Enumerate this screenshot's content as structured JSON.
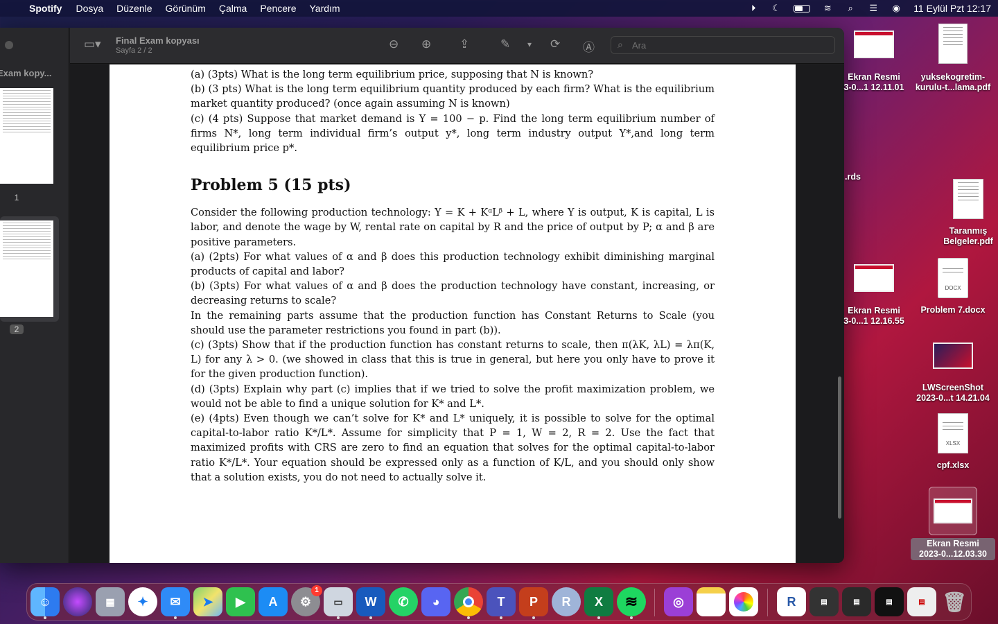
{
  "menubar": {
    "app_name": "Spotify",
    "items": [
      "Dosya",
      "Düzenle",
      "Görünüm",
      "Çalma",
      "Pencere",
      "Yardım"
    ],
    "datetime": "11 Eylül Pzt  12:17"
  },
  "viewer": {
    "sidebar_doc_title": "Exam kopy...",
    "thumb_labels": [
      "1",
      "2"
    ],
    "doc_title": "Final Exam kopyası",
    "page_indicator": "Sayfa 2 / 2",
    "search_placeholder": "Ara"
  },
  "document": {
    "p_a": "(a) (3pts) What is the long term equilibrium price, supposing that N is known?",
    "p_b": "(b) (3 pts) What is the long term equilibrium quantity produced by each firm?  What is the equilibrium market quantity produced? (once again assuming N is known)",
    "p_c": "(c) (4 pts) Suppose that market demand is Y = 100 − p.  Find the long term equilibrium number of firms N*, long term individual firm’s output y*, long term industry output Y*,and long term equilibrium price p*.",
    "problem_title": "Problem 5 (15 pts)",
    "p5_intro": "Consider the following production technology: Y = K + KᵅLᵝ + L, where Y is output, K is capital, L is labor, and denote the wage by W, rental rate on capital by R and the price of output by P; α and β are positive parameters.",
    "p5_a": "(a) (2pts) For what values of α and β does this production technology exhibit diminishing marginal products of capital and labor?",
    "p5_b": "(b) (3pts) For what values of α and β does the production technology have constant, increasing, or decreasing returns to scale?",
    "p5_remaining": "In the remaining parts assume that the production function has Constant Returns to Scale (you should use the parameter restrictions you found in part (b)).",
    "p5_c": "(c) (3pts) Show that if the production function has constant returns to scale, then π(λK, λL) = λπ(K, L) for any λ > 0.  (we showed in class that this is true in general, but here you only have to prove it for the given production function).",
    "p5_d": "(d) (3pts) Explain why part (c) implies that if we tried to solve the profit maximization problem, we would not be able to find a unique solution for K* and L*.",
    "p5_e": "(e) (4pts) Even though we can’t solve for K* and L* uniquely, it is possible to solve for the optimal capital-to-labor ratio K*/L*.  Assume for simplicity that P = 1, W = 2, R = 2.  Use the fact that maximized profits with CRS are zero to find an equation that solves for the optimal capital-to-labor ratio K*/L*. Your equation should be expressed only as a function of K/L, and you should only show that a solution exists, you do not need to actually solve it."
  },
  "desktop": {
    "icons": [
      {
        "line1": "Ekran Resmi",
        "line2": "3-0...1 12.11.01"
      },
      {
        "line1": "yuksekogretim-",
        "line2": "kurulu-t...lama.pdf"
      },
      {
        "line1": ".rds",
        "line2": ""
      },
      {
        "line1": "Taranmış",
        "line2": "Belgeler.pdf"
      },
      {
        "line1": "Ekran Resmi",
        "line2": "3-0...1 12.16.55"
      },
      {
        "line1": "Problem 7.docx",
        "line2": ""
      },
      {
        "line1": "LWScreenShot",
        "line2": "2023-0...t 14.21.04"
      },
      {
        "line1": "cpf.xlsx",
        "line2": ""
      },
      {
        "line1": "Ekran Resmi",
        "line2": "2023-0...12.03.30"
      }
    ],
    "file_types": [
      "DOCX",
      "XLSX"
    ]
  },
  "dock": {
    "apps": [
      "Finder",
      "Siri",
      "Launchpad",
      "Safari",
      "Mail",
      "Maps",
      "FaceTime",
      "App Store",
      "System Settings",
      "Preview",
      "Word",
      "WhatsApp",
      "Discord",
      "Chrome",
      "Teams",
      "PowerPoint",
      "R",
      "Excel",
      "Spotify",
      "Podcasts",
      "Notes",
      "Photos"
    ],
    "settings_badge": "1",
    "letters": {
      "word": "W",
      "r": "R",
      "excel": "X",
      "ppt": "P"
    }
  },
  "colors": {
    "spotify": "#1ed760",
    "whatsapp": "#25d366",
    "discord": "#5865f2",
    "word": "#185abd",
    "excel": "#107c41",
    "powerpoint": "#c43e1c",
    "teams": "#4b53bc",
    "badge": "#ff3b30"
  }
}
